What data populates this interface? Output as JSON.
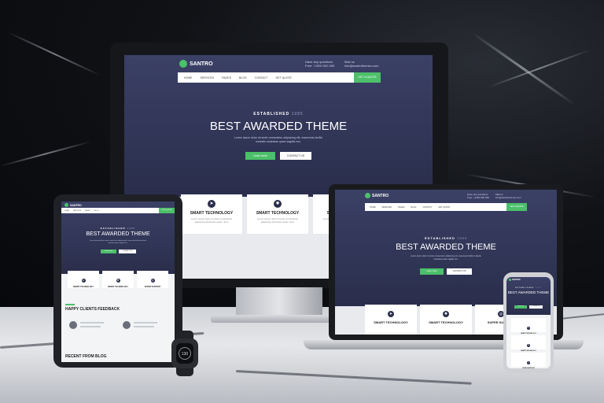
{
  "brand": {
    "name": "SANTRO"
  },
  "contact": {
    "phone_label": "Have any questions",
    "phone_value": "Free: +1900 000 000",
    "email_label": "Mail us",
    "email_value": "info@santrothemes.com"
  },
  "nav": {
    "items": [
      "Home",
      "Services",
      "Pages",
      "Blog",
      "Contact",
      "Get quote"
    ],
    "cta_label": "Get a quote"
  },
  "hero": {
    "established_label": "ESTABLISHED",
    "established_year": "1985",
    "headline": "BEST AWARDED THEME",
    "subtext": "Lorem ipsum dolor sit amet consectetur adipiscing elit, maecenas facilisi molestie molestias quam sagittis nec.",
    "button_primary": "Learn more",
    "button_secondary": "CONTACT US"
  },
  "features": [
    {
      "icon": "rocket-icon",
      "title": "SMART TECHNOLOGY",
      "desc": "Lorem ipsum dolor sit amet consectetur adipiscing elit fames quam nunc"
    },
    {
      "icon": "gear-icon",
      "title": "SMART TECHNOLOGY",
      "desc": "Lorem ipsum dolor sit amet consectetur adipiscing elit fames quam nunc"
    },
    {
      "icon": "target-icon",
      "title": "SUPER SUPPORT",
      "desc": "Lorem ipsum dolor sit amet consectetur"
    }
  ],
  "tablet": {
    "testimonials_title": "HAPPY CLIENTS FEEDBACK",
    "blog_title": "RECENT FROM BLOG"
  },
  "watch": {
    "value": "130"
  },
  "colors": {
    "accent": "#4cc06a",
    "hero_bg": "#2f3352"
  }
}
